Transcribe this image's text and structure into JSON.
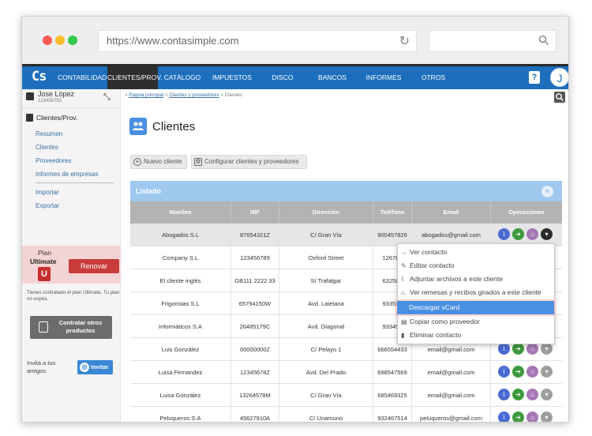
{
  "browser": {
    "url": "https://www.contasimple.com",
    "reload_icon": "reload-icon",
    "search_icon": "search-icon"
  },
  "nav": {
    "logo": "Cs",
    "items": [
      {
        "label": "CONTABILIDAD",
        "active": false
      },
      {
        "label": "CLIENTES/PROV.",
        "active": true
      },
      {
        "label": "CATÁLOGO",
        "active": false
      },
      {
        "label": "IMPUESTOS",
        "active": false
      },
      {
        "label": "DISCO VIRTUAL",
        "active": false
      },
      {
        "label": "BANCOS",
        "active": false
      },
      {
        "label": "INFORMES",
        "active": false
      },
      {
        "label": "OTROS",
        "active": false
      }
    ],
    "help": "?",
    "avatar": "J"
  },
  "user": {
    "name": "Jose López",
    "id": "123456782"
  },
  "sidebar": {
    "section_title": "Clientes/Prov.",
    "links": [
      "Resumen",
      "Clientes",
      "Proveedores",
      "Informes de empresas"
    ],
    "links2": [
      "Importar",
      "Exportar"
    ],
    "plan_label": "Plan",
    "plan_name": "Ultimate",
    "plan_badge": "U",
    "renew": "Renovar",
    "plan_note": "Tienes contratado el plan Ultimate. Tu plan no expira.",
    "contract": "Contratar otros productos",
    "invite_text": "Invita a tus amigos",
    "invite_button": "Invitar"
  },
  "breadcrumb": {
    "prefix": "»",
    "home": "Página principal",
    "sep": ">",
    "parent": "Clientes y proveedores",
    "current": "Clientes"
  },
  "page": {
    "title": "Clientes",
    "new_client": "Nuevo cliente",
    "configure": "Configurar clientes y proveedores",
    "listado": "Listado"
  },
  "table": {
    "headers": [
      "Nombre",
      "NIF",
      "Dirección",
      "Teléfono",
      "Email",
      "Operaciones"
    ],
    "rows": [
      {
        "nombre": "Abogados S.L",
        "nif": "87654321Z",
        "direccion": "C/ Gran Vía",
        "telefono": "900457826",
        "email": "abogados@gmail.com",
        "selected": true
      },
      {
        "nombre": "Company S.L",
        "nif": "123456789",
        "direccion": "Oxford Street",
        "telefono": "126785",
        "email": "",
        "selected": false
      },
      {
        "nombre": "El cliente inglés",
        "nif": "GB111 2222 33",
        "direccion": "S/ Trafalgar",
        "telefono": "632587",
        "email": "",
        "selected": false
      },
      {
        "nombre": "Frigoristas S.L",
        "nif": "65794150W",
        "direccion": "Avd. Laietana",
        "telefono": "933560",
        "email": "",
        "selected": false
      },
      {
        "nombre": "Informáticos S.A",
        "nif": "26485179C",
        "direccion": "Avd. Diagonal",
        "telefono": "933457",
        "email": "",
        "selected": false
      },
      {
        "nombre": "Luis González",
        "nif": "00000000Z",
        "direccion": "C/ Pelayo 1",
        "telefono": "666554433",
        "email": "email@gmail.com",
        "selected": false
      },
      {
        "nombre": "Luisa Fernandez",
        "nif": "12345678Z",
        "direccion": "Avd. Del Prado",
        "telefono": "698547569",
        "email": "email@gmail.com",
        "selected": false
      },
      {
        "nombre": "Luisa González",
        "nif": "13264578M",
        "direccion": "C/ Gran Vía",
        "telefono": "685469325",
        "email": "email@gmail.com",
        "selected": false
      },
      {
        "nombre": "Peluqueros S.A",
        "nif": "45627910A",
        "direccion": "C/ Unamuno",
        "telefono": "932467514",
        "email": "peluqueros@gmail.com",
        "selected": false
      }
    ]
  },
  "menu": {
    "items": [
      {
        "label": "Ver contacto",
        "icon": "→"
      },
      {
        "label": "Editar contacto",
        "icon": "✎"
      },
      {
        "label": "Adjuntar archivos a este cliente",
        "icon": "⌇"
      },
      {
        "label": "Ver remesas y recibos girados a este cliente",
        "icon": "⌂"
      },
      {
        "label": "Descargar vCard",
        "icon": "",
        "highlighted": true
      },
      {
        "label": "Copiar como proveedor",
        "icon": "▤"
      },
      {
        "label": "Eliminar contacto",
        "icon": "▮"
      }
    ]
  },
  "colors": {
    "nav_blue": "#1d6fbd",
    "active_tab": "#2e2e2e",
    "listado": "#9fc8ef",
    "highlight": "#4a90e2",
    "renew": "#c73b3b"
  }
}
